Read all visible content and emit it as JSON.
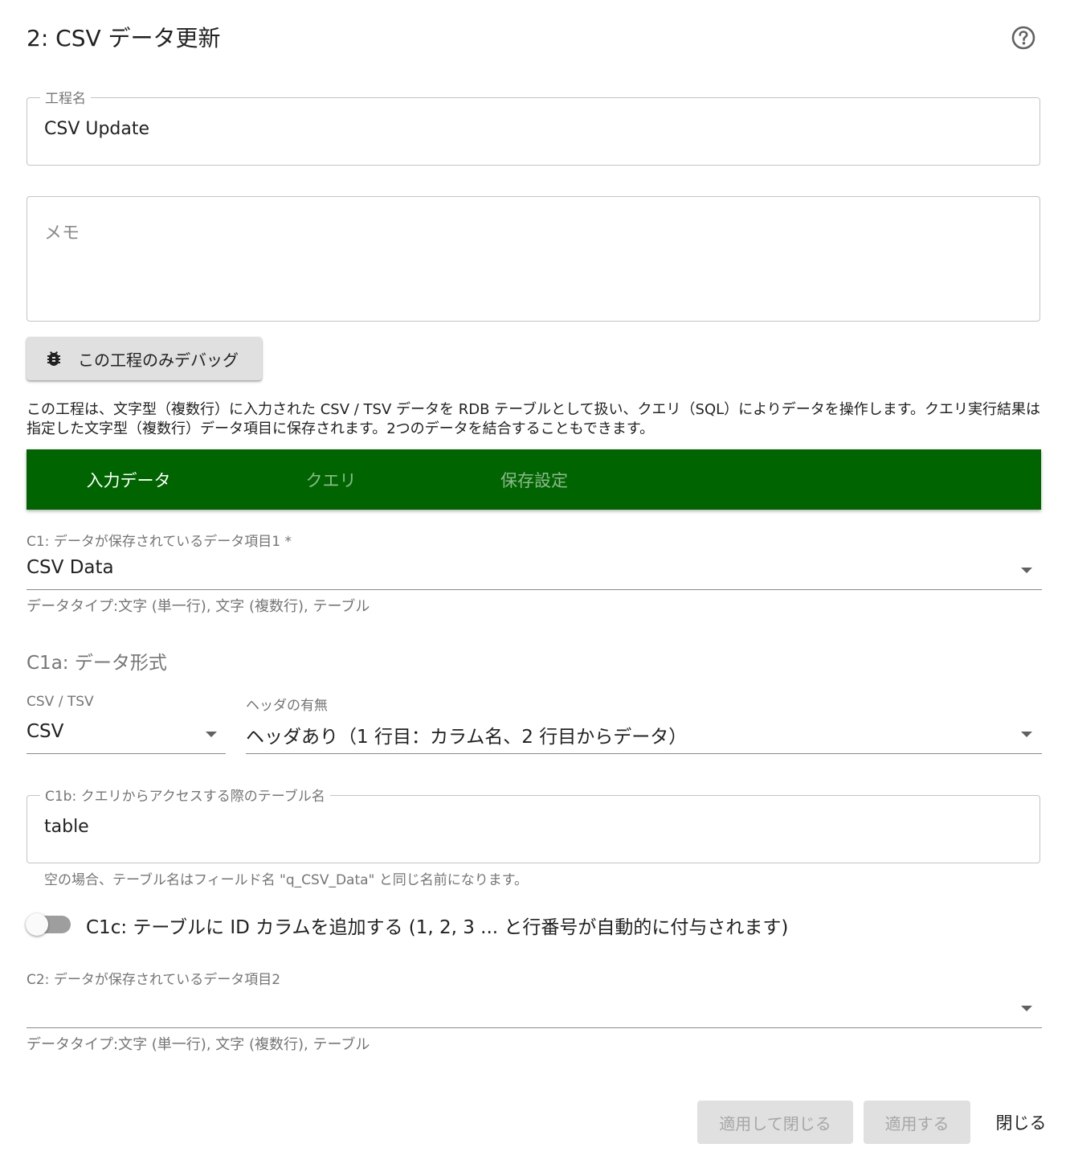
{
  "dialog": {
    "title": "2: CSV データ更新",
    "help_icon": "help-circle-icon"
  },
  "step_name": {
    "label": "工程名",
    "value": "CSV Update"
  },
  "memo": {
    "placeholder": "メモ",
    "value": ""
  },
  "debug_button": {
    "label": "この工程のみデバッグ",
    "icon": "bug-icon"
  },
  "description": "この工程は、文字型（複数行）に入力された CSV / TSV データを RDB テーブルとして扱い、クエリ（SQL）によりデータを操作します。クエリ実行結果は指定した文字型（複数行）データ項目に保存されます。2つのデータを結合することもできます。",
  "tabs": [
    {
      "label": "入力データ",
      "active": true
    },
    {
      "label": "クエリ",
      "active": false
    },
    {
      "label": "保存設定",
      "active": false
    }
  ],
  "c1": {
    "label": "C1: データが保存されているデータ項目1 *",
    "value": "CSV Data",
    "helper": "データタイプ:文字 (単一行), 文字 (複数行), テーブル"
  },
  "c1a": {
    "title": "C1a: データ形式",
    "format": {
      "label": "CSV / TSV",
      "value": "CSV"
    },
    "header": {
      "label": "ヘッダの有無",
      "value": "ヘッダあり（1 行目：カラム名、2 行目からデータ）"
    }
  },
  "c1b": {
    "label": "C1b: クエリからアクセスする際のテーブル名",
    "value": "table",
    "helper": "空の場合、テーブル名はフィールド名 \"q_CSV_Data\" と同じ名前になります。"
  },
  "c1c": {
    "label": "C1c: テーブルに ID カラムを追加する (1, 2, 3 ... と行番号が自動的に付与されます)",
    "checked": false
  },
  "c2": {
    "label": "C2: データが保存されているデータ項目2",
    "value": "",
    "helper": "データタイプ:文字 (単一行), 文字 (複数行), テーブル"
  },
  "actions": {
    "apply_close": "適用して閉じる",
    "apply": "適用する",
    "close": "閉じる"
  },
  "colors": {
    "tab_bar": "#006400",
    "button_disabled_bg": "#e0e0e0"
  }
}
